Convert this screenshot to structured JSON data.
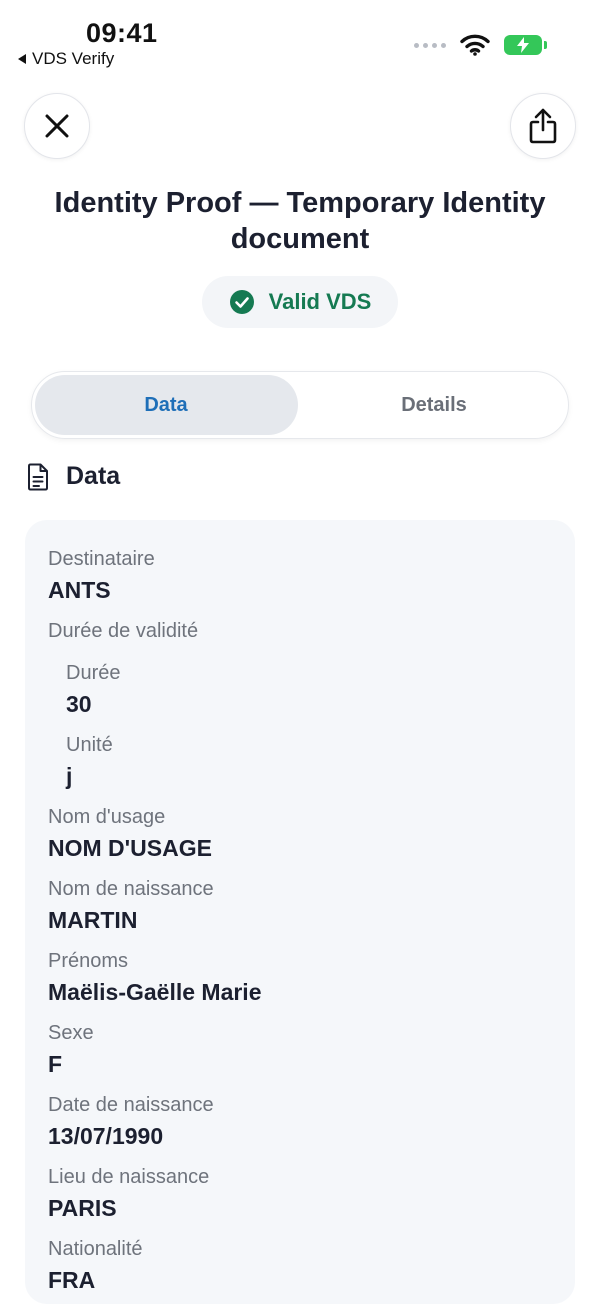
{
  "status_bar": {
    "time": "09:41",
    "back_label": "VDS Verify"
  },
  "header": {
    "title": "Identity Proof — Temporary Identity document",
    "badge": "Valid VDS"
  },
  "tabs": [
    {
      "label": "Data",
      "active": true
    },
    {
      "label": "Details",
      "active": false
    }
  ],
  "section": {
    "title": "Data"
  },
  "fields": {
    "destinataire": {
      "label": "Destinataire",
      "value": "ANTS"
    },
    "duree_validite": {
      "label": "Durée de validité"
    },
    "duree": {
      "label": "Durée",
      "value": "30"
    },
    "unite": {
      "label": "Unité",
      "value": "j"
    },
    "nom_usage": {
      "label": "Nom d'usage",
      "value": "NOM D'USAGE"
    },
    "nom_naissance": {
      "label": "Nom de naissance",
      "value": "MARTIN"
    },
    "prenoms": {
      "label": "Prénoms",
      "value": "Maëlis-Gaëlle Marie"
    },
    "sexe": {
      "label": "Sexe",
      "value": "F"
    },
    "date_naissance": {
      "label": "Date de naissance",
      "value": "13/07/1990"
    },
    "lieu_naissance": {
      "label": "Lieu de naissance",
      "value": "PARIS"
    },
    "nationalite": {
      "label": "Nationalité",
      "value": "FRA"
    }
  },
  "colors": {
    "valid_green": "#157a52",
    "active_tab_blue": "#1f6fb8",
    "battery_green": "#34c759",
    "card_background": "#f5f7fa"
  },
  "icons": {
    "close": "close-icon",
    "share": "share-icon",
    "valid": "check-circle-icon",
    "section": "document-icon",
    "wifi": "wifi-icon",
    "battery": "battery-charging-icon"
  }
}
